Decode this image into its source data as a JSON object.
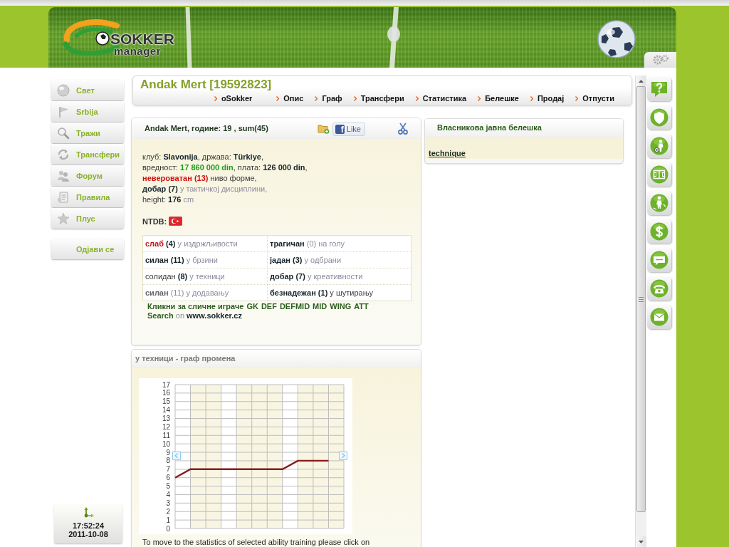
{
  "header": {
    "logo_title": "SOKKER",
    "logo_subtitle": "manager"
  },
  "sidebar": {
    "items": [
      {
        "label": "Свет"
      },
      {
        "label": "Srbija"
      },
      {
        "label": "Тражи"
      },
      {
        "label": "Трансфери"
      },
      {
        "label": "Форум"
      },
      {
        "label": "Правила"
      },
      {
        "label": "Плус"
      }
    ],
    "logout": "Одјави се",
    "clock": {
      "time": "17:52:24",
      "date": "2011-10-08"
    }
  },
  "title_bar": {
    "title": "Andak Mert [19592823]",
    "links": [
      "oSokker",
      "Опис",
      "Граф",
      "Трансфери",
      "Статистика",
      "Белешке",
      "Продај",
      "Отпусти"
    ]
  },
  "player_card": {
    "heading": "Andak Mert, године: 19 , sum(45)",
    "like_button": {
      "logo": "f",
      "label": "Like"
    },
    "details": [
      [
        {
          "text": "клуб: ",
          "kind": "plain"
        },
        {
          "text": "Slavonija",
          "kind": "strong"
        },
        {
          "text": ", држава: ",
          "kind": "plain"
        },
        {
          "text": "Türkiye",
          "kind": "strong"
        },
        {
          "text": ",",
          "kind": "plain"
        }
      ],
      [
        {
          "text": "вредност: ",
          "kind": "plain"
        },
        {
          "text": "17 860 000 din",
          "kind": "good"
        },
        {
          "text": ", плата: ",
          "kind": "plain"
        },
        {
          "text": "126 000 din",
          "kind": "strong"
        },
        {
          "text": ",",
          "kind": "plain"
        }
      ],
      [
        {
          "text": "невероватан (13)",
          "kind": "bad"
        },
        {
          "text": " ниво форме,",
          "kind": "plain"
        }
      ],
      [
        {
          "text": "добар (7)",
          "kind": "strong"
        },
        {
          "text": " у тактичкој дисциплини,",
          "kind": "dim"
        }
      ],
      [
        {
          "text": "height: ",
          "kind": "plain"
        },
        {
          "text": "176",
          "kind": "strong"
        },
        {
          "text": " cm",
          "kind": "dim"
        }
      ]
    ],
    "ntdb_label": "NTDB:",
    "skills": [
      [
        [
          {
            "text": "слаб",
            "kind": "bad"
          },
          {
            "text": " (4)",
            "kind": "strong"
          },
          {
            "text": " у издржљивости",
            "kind": "dim"
          }
        ],
        [
          {
            "text": "трагичан",
            "kind": "strong"
          },
          {
            "text": " (0)",
            "kind": "dim"
          },
          {
            "text": " на голу",
            "kind": "dim"
          }
        ]
      ],
      [
        [
          {
            "text": "силан (11)",
            "kind": "strong"
          },
          {
            "text": " у брзини",
            "kind": "dim"
          }
        ],
        [
          {
            "text": "јадан (3)",
            "kind": "strong"
          },
          {
            "text": " у одбрани",
            "kind": "dim"
          }
        ]
      ],
      [
        [
          {
            "text": "солидан",
            "kind": "plain"
          },
          {
            "text": " (8)",
            "kind": "strong"
          },
          {
            "text": " у техници",
            "kind": "dim"
          }
        ],
        [
          {
            "text": "добар (7)",
            "kind": "strong"
          },
          {
            "text": " у креативности",
            "kind": "dim"
          }
        ]
      ],
      [
        [
          {
            "text": "силан",
            "kind": "soft"
          },
          {
            "text": " (11) у додавању",
            "kind": "dim"
          }
        ],
        [
          {
            "text": "безнадежан (1)",
            "kind": "strong"
          },
          {
            "text": " у шутирању",
            "kind": "plain"
          }
        ]
      ]
    ],
    "similar_label": "Кликни за сличне играче",
    "positions": [
      "GK",
      "DEF",
      "DEFMID",
      "MID",
      "WING",
      "ATT"
    ],
    "search_line": [
      {
        "text": "Search",
        "kind": "link"
      },
      {
        "text": " on ",
        "kind": "dim"
      },
      {
        "text": "www.sokker.cz",
        "kind": "strong"
      }
    ]
  },
  "note_card": {
    "title": "Власникова јавна белешка",
    "link": "technique"
  },
  "chart_panel": {
    "title": "у техници - граф промена",
    "chart_data": {
      "type": "line",
      "grid": true,
      "ylim": [
        0,
        17
      ],
      "yticks": [
        0,
        1,
        2,
        3,
        4,
        5,
        6,
        7,
        8,
        9,
        10,
        11,
        12,
        13,
        14,
        15,
        16,
        17
      ],
      "series": [
        {
          "color": "#8b1a1a",
          "values": [
            6,
            7,
            7,
            7,
            7,
            7,
            7,
            7,
            8,
            8,
            8
          ]
        }
      ]
    },
    "footer": "To move to the statistics of selected ability training please click on"
  }
}
